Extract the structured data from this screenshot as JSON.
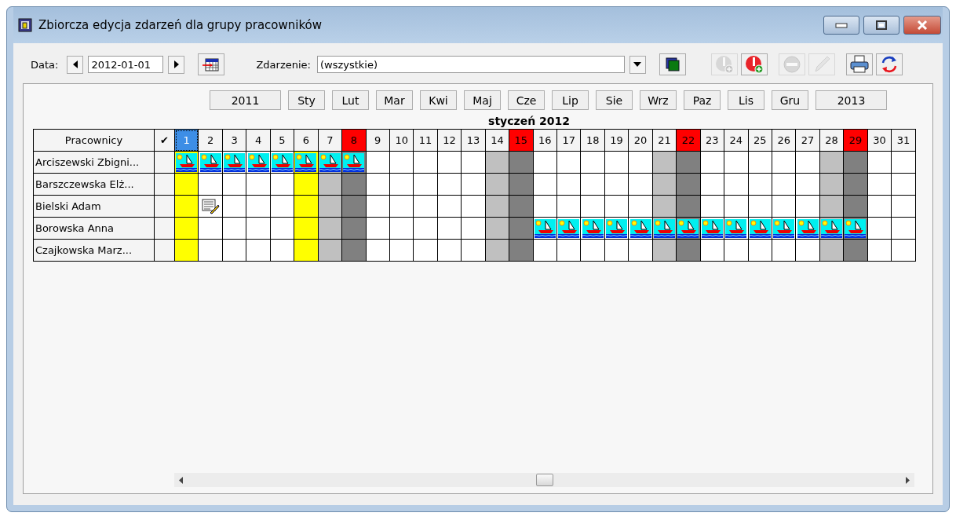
{
  "window": {
    "title": "Zbiorcza edycja zdarzeń dla grupy pracowników"
  },
  "toolbar": {
    "date_label": "Data:",
    "date_value": "2012-01-01",
    "event_label": "Zdarzenie:",
    "event_value": "(wszystkie)",
    "actions": [
      {
        "kind": "add-grey",
        "disabled": true
      },
      {
        "kind": "add-red",
        "disabled": false
      },
      {
        "kind": "remove",
        "disabled": true
      },
      {
        "kind": "edit",
        "disabled": true
      },
      {
        "kind": "print",
        "disabled": false
      },
      {
        "kind": "refresh",
        "disabled": false
      }
    ]
  },
  "months": [
    {
      "label": "2011",
      "kind": "year"
    },
    {
      "label": "Sty",
      "kind": "month"
    },
    {
      "label": "Lut",
      "kind": "month"
    },
    {
      "label": "Mar",
      "kind": "month"
    },
    {
      "label": "Kwi",
      "kind": "month"
    },
    {
      "label": "Maj",
      "kind": "month"
    },
    {
      "label": "Cze",
      "kind": "month"
    },
    {
      "label": "Lip",
      "kind": "month"
    },
    {
      "label": "Sie",
      "kind": "month"
    },
    {
      "label": "Wrz",
      "kind": "month"
    },
    {
      "label": "Paz",
      "kind": "month"
    },
    {
      "label": "Lis",
      "kind": "month"
    },
    {
      "label": "Gru",
      "kind": "month"
    },
    {
      "label": "2013",
      "kind": "year"
    }
  ],
  "calendar": {
    "title": "styczeń 2012",
    "name_header": "Pracownicy",
    "check_header": "✔",
    "days": [
      {
        "label": "1",
        "kind": "holiday",
        "selected": true
      },
      {
        "label": "2",
        "kind": "workday",
        "selected": false
      },
      {
        "label": "3",
        "kind": "workday",
        "selected": false
      },
      {
        "label": "4",
        "kind": "workday",
        "selected": false
      },
      {
        "label": "5",
        "kind": "workday",
        "selected": false
      },
      {
        "label": "6",
        "kind": "holiday",
        "selected": false
      },
      {
        "label": "7",
        "kind": "saturday",
        "selected": false
      },
      {
        "label": "8",
        "kind": "sunday",
        "selected": false
      },
      {
        "label": "9",
        "kind": "workday",
        "selected": false
      },
      {
        "label": "10",
        "kind": "workday",
        "selected": false
      },
      {
        "label": "11",
        "kind": "workday",
        "selected": false
      },
      {
        "label": "12",
        "kind": "workday",
        "selected": false
      },
      {
        "label": "13",
        "kind": "workday",
        "selected": false
      },
      {
        "label": "14",
        "kind": "saturday",
        "selected": false
      },
      {
        "label": "15",
        "kind": "sunday",
        "selected": false
      },
      {
        "label": "16",
        "kind": "workday",
        "selected": false
      },
      {
        "label": "17",
        "kind": "workday",
        "selected": false
      },
      {
        "label": "18",
        "kind": "workday",
        "selected": false
      },
      {
        "label": "19",
        "kind": "workday",
        "selected": false
      },
      {
        "label": "20",
        "kind": "workday",
        "selected": false
      },
      {
        "label": "21",
        "kind": "saturday",
        "selected": false
      },
      {
        "label": "22",
        "kind": "sunday",
        "selected": false
      },
      {
        "label": "23",
        "kind": "workday",
        "selected": false
      },
      {
        "label": "24",
        "kind": "workday",
        "selected": false
      },
      {
        "label": "25",
        "kind": "workday",
        "selected": false
      },
      {
        "label": "26",
        "kind": "workday",
        "selected": false
      },
      {
        "label": "27",
        "kind": "workday",
        "selected": false
      },
      {
        "label": "28",
        "kind": "saturday",
        "selected": false
      },
      {
        "label": "29",
        "kind": "sunday",
        "selected": false
      },
      {
        "label": "30",
        "kind": "workday",
        "selected": false
      },
      {
        "label": "31",
        "kind": "workday",
        "selected": false
      }
    ],
    "rows": [
      {
        "name": "Arciszewski Zbigni...",
        "cells": [
          {
            "kind": "vacation"
          },
          {
            "kind": "vacation"
          },
          {
            "kind": "vacation"
          },
          {
            "kind": "vacation"
          },
          {
            "kind": "vacation"
          },
          {
            "kind": "vacation"
          },
          {
            "kind": "vacation"
          },
          {
            "kind": "vacation"
          },
          {
            "kind": "none"
          },
          {
            "kind": "none"
          },
          {
            "kind": "none"
          },
          {
            "kind": "none"
          },
          {
            "kind": "none"
          },
          {
            "kind": "none"
          },
          {
            "kind": "none"
          },
          {
            "kind": "none"
          },
          {
            "kind": "none"
          },
          {
            "kind": "none"
          },
          {
            "kind": "none"
          },
          {
            "kind": "none"
          },
          {
            "kind": "none"
          },
          {
            "kind": "none"
          },
          {
            "kind": "none"
          },
          {
            "kind": "none"
          },
          {
            "kind": "none"
          },
          {
            "kind": "none"
          },
          {
            "kind": "none"
          },
          {
            "kind": "none"
          },
          {
            "kind": "none"
          },
          {
            "kind": "none"
          },
          {
            "kind": "none"
          }
        ]
      },
      {
        "name": "Barszczewska Elż...",
        "cells": [
          {
            "kind": "none"
          },
          {
            "kind": "none"
          },
          {
            "kind": "none"
          },
          {
            "kind": "none"
          },
          {
            "kind": "none"
          },
          {
            "kind": "none"
          },
          {
            "kind": "none"
          },
          {
            "kind": "none"
          },
          {
            "kind": "none"
          },
          {
            "kind": "none"
          },
          {
            "kind": "none"
          },
          {
            "kind": "none"
          },
          {
            "kind": "none"
          },
          {
            "kind": "none"
          },
          {
            "kind": "none"
          },
          {
            "kind": "none"
          },
          {
            "kind": "none"
          },
          {
            "kind": "none"
          },
          {
            "kind": "none"
          },
          {
            "kind": "none"
          },
          {
            "kind": "none"
          },
          {
            "kind": "none"
          },
          {
            "kind": "none"
          },
          {
            "kind": "none"
          },
          {
            "kind": "none"
          },
          {
            "kind": "none"
          },
          {
            "kind": "none"
          },
          {
            "kind": "none"
          },
          {
            "kind": "none"
          },
          {
            "kind": "none"
          },
          {
            "kind": "none"
          }
        ]
      },
      {
        "name": "Bielski Adam",
        "cells": [
          {
            "kind": "none"
          },
          {
            "kind": "note"
          },
          {
            "kind": "none"
          },
          {
            "kind": "none"
          },
          {
            "kind": "none"
          },
          {
            "kind": "none"
          },
          {
            "kind": "none"
          },
          {
            "kind": "none"
          },
          {
            "kind": "none"
          },
          {
            "kind": "none"
          },
          {
            "kind": "none"
          },
          {
            "kind": "none"
          },
          {
            "kind": "none"
          },
          {
            "kind": "none"
          },
          {
            "kind": "none"
          },
          {
            "kind": "none"
          },
          {
            "kind": "none"
          },
          {
            "kind": "none"
          },
          {
            "kind": "none"
          },
          {
            "kind": "none"
          },
          {
            "kind": "none"
          },
          {
            "kind": "none"
          },
          {
            "kind": "none"
          },
          {
            "kind": "none"
          },
          {
            "kind": "none"
          },
          {
            "kind": "none"
          },
          {
            "kind": "none"
          },
          {
            "kind": "none"
          },
          {
            "kind": "none"
          },
          {
            "kind": "none"
          },
          {
            "kind": "none"
          }
        ]
      },
      {
        "name": "Borowska Anna",
        "cells": [
          {
            "kind": "none"
          },
          {
            "kind": "none"
          },
          {
            "kind": "none"
          },
          {
            "kind": "none"
          },
          {
            "kind": "none"
          },
          {
            "kind": "none"
          },
          {
            "kind": "none"
          },
          {
            "kind": "none"
          },
          {
            "kind": "none"
          },
          {
            "kind": "none"
          },
          {
            "kind": "none"
          },
          {
            "kind": "none"
          },
          {
            "kind": "none"
          },
          {
            "kind": "none"
          },
          {
            "kind": "none"
          },
          {
            "kind": "vacation"
          },
          {
            "kind": "vacation"
          },
          {
            "kind": "vacation"
          },
          {
            "kind": "vacation"
          },
          {
            "kind": "vacation"
          },
          {
            "kind": "vacation"
          },
          {
            "kind": "vacation"
          },
          {
            "kind": "vacation"
          },
          {
            "kind": "vacation"
          },
          {
            "kind": "vacation"
          },
          {
            "kind": "vacation"
          },
          {
            "kind": "vacation"
          },
          {
            "kind": "vacation"
          },
          {
            "kind": "vacation"
          },
          {
            "kind": "none"
          },
          {
            "kind": "none"
          }
        ]
      },
      {
        "name": "Czajkowska Marz...",
        "cells": [
          {
            "kind": "none"
          },
          {
            "kind": "none"
          },
          {
            "kind": "none"
          },
          {
            "kind": "none"
          },
          {
            "kind": "none"
          },
          {
            "kind": "none"
          },
          {
            "kind": "none"
          },
          {
            "kind": "none"
          },
          {
            "kind": "none"
          },
          {
            "kind": "none"
          },
          {
            "kind": "none"
          },
          {
            "kind": "none"
          },
          {
            "kind": "none"
          },
          {
            "kind": "none"
          },
          {
            "kind": "none"
          },
          {
            "kind": "none"
          },
          {
            "kind": "none"
          },
          {
            "kind": "none"
          },
          {
            "kind": "none"
          },
          {
            "kind": "none"
          },
          {
            "kind": "none"
          },
          {
            "kind": "none"
          },
          {
            "kind": "none"
          },
          {
            "kind": "none"
          },
          {
            "kind": "none"
          },
          {
            "kind": "none"
          },
          {
            "kind": "none"
          },
          {
            "kind": "none"
          },
          {
            "kind": "none"
          },
          {
            "kind": "none"
          },
          {
            "kind": "none"
          }
        ]
      }
    ]
  }
}
